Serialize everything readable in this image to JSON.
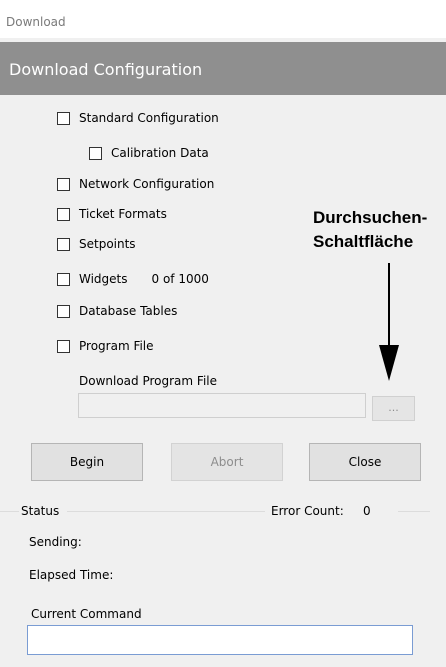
{
  "window": {
    "title": "Download"
  },
  "header": {
    "title": "Download Configuration"
  },
  "options": {
    "standard_configuration": "Standard Configuration",
    "calibration_data": "Calibration Data",
    "network_configuration": "Network Configuration",
    "ticket_formats": "Ticket Formats",
    "setpoints": "Setpoints",
    "widgets": "Widgets",
    "widgets_count": "0 of 1000",
    "database_tables": "Database Tables",
    "program_file": "Program File"
  },
  "program_file_field": {
    "label": "Download Program File",
    "value": "",
    "browse_label": "..."
  },
  "annotation": {
    "line1": "Durchsuchen-",
    "line2": "Schaltfläche"
  },
  "buttons": {
    "begin": "Begin",
    "abort": "Abort",
    "close": "Close"
  },
  "status": {
    "group_label": "Status",
    "error_count_label": "Error Count:",
    "error_count_value": "0",
    "sending_label": "Sending:",
    "elapsed_time_label": "Elapsed Time:",
    "current_command_label": "Current Command",
    "current_command_value": ""
  }
}
